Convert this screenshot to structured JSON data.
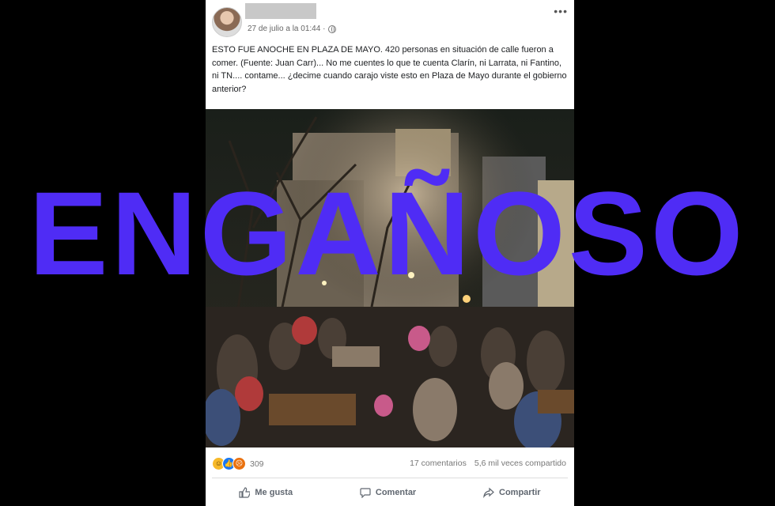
{
  "post": {
    "timestamp": "27 de julio a la 01:44 ·",
    "text": "ESTO FUE ANOCHE EN PLAZA DE MAYO. 420 personas en situación de calle fueron a comer. (Fuente: Juan Carr)... No me cuentes lo que te cuenta Clarín, ni Larrata, ni Fantino, ni TN.... contame... ¿decime cuando carajo viste esto en Plaza de Mayo durante el gobierno anterior?",
    "more_icon": "more-horizontal-icon",
    "privacy_icon": "globe-icon"
  },
  "stats": {
    "reaction_count": "309",
    "comments": "17 comentarios",
    "shares": "5,6 mil veces compartido",
    "reaction_icons": [
      "laugh-reaction-icon",
      "like-reaction-icon",
      "angry-reaction-icon"
    ]
  },
  "actions": {
    "like": "Me gusta",
    "comment": "Comentar",
    "share": "Compartir"
  },
  "overlay": {
    "label": "ENGAÑOSO",
    "color": "#4f2cf5"
  }
}
